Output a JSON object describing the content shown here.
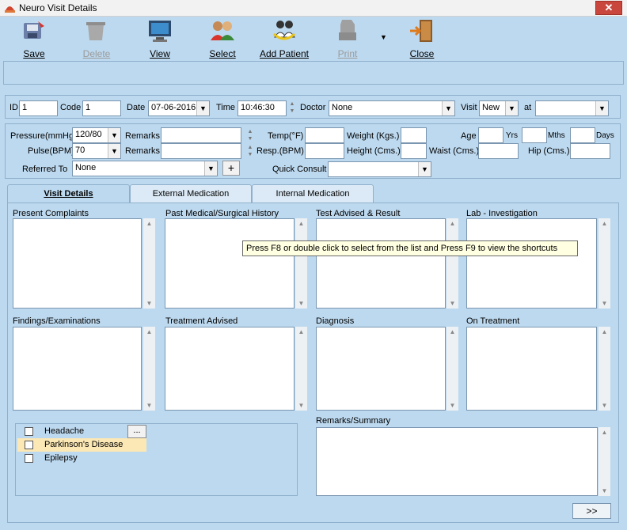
{
  "window": {
    "title": "Neuro Visit Details",
    "close_glyph": "✕"
  },
  "toolbar": {
    "save": "Save",
    "delete": "Delete",
    "view": "View",
    "select": "Select",
    "add_patient": "Add Patient",
    "print": "Print",
    "close": "Close"
  },
  "header": {
    "id_label": "ID",
    "id_value": "1",
    "code_label": "Code",
    "code_value": "1",
    "date_label": "Date",
    "date_value": "07-06-2016",
    "time_label": "Time",
    "time_value": "10:46:30",
    "doctor_label": "Doctor",
    "doctor_value": "None",
    "visit_label": "Visit",
    "visit_value": "New",
    "at_label": "at",
    "at_value": ""
  },
  "vitals": {
    "pressure_label": "Pressure(mmHg)",
    "pressure_value": "120/80",
    "pulse_label": "Pulse(BPM)",
    "pulse_value": "70",
    "remarks_label": "Remarks",
    "temp_label": "Temp(°F)",
    "resp_label": "Resp.(BPM)",
    "weight_label": "Weight (Kgs.)",
    "height_label": "Height (Cms.)",
    "age_label": "Age",
    "yrs_label": "Yrs",
    "mths_label": "Mths",
    "days_label": "Days",
    "waist_label": "Waist (Cms.)",
    "hip_label": "Hip (Cms.)",
    "referred_label": "Referred To",
    "referred_value": "None",
    "quick_consult_label": "Quick Consult",
    "quick_consult_value": "",
    "plus": "+"
  },
  "tabs": [
    "Visit Details",
    "External Medication",
    "Internal Medication"
  ],
  "sections": {
    "present_complaints": "Present Complaints",
    "past_history": "Past Medical/Surgical History",
    "test_advised": "Test Advised & Result",
    "lab_investigation": "Lab - Investigation",
    "findings": "Findings/Examinations",
    "treatment_advised": "Treatment Advised",
    "diagnosis": "Diagnosis",
    "on_treatment": "On Treatment",
    "remarks_summary": "Remarks/Summary"
  },
  "tooltip": "Press F8 or double click to select from the list and Press F9 to view the shortcuts",
  "diseases": [
    {
      "name": "Headache",
      "checked": false
    },
    {
      "name": "Parkinson's Disease",
      "checked": false
    },
    {
      "name": "Epilepsy",
      "checked": false
    }
  ],
  "ellipsis": "...",
  "next_button": ">>",
  "colors": {
    "window_bg": "#bdd9ef",
    "tooltip_bg": "#ffffe1",
    "close_red": "#c9463d"
  }
}
